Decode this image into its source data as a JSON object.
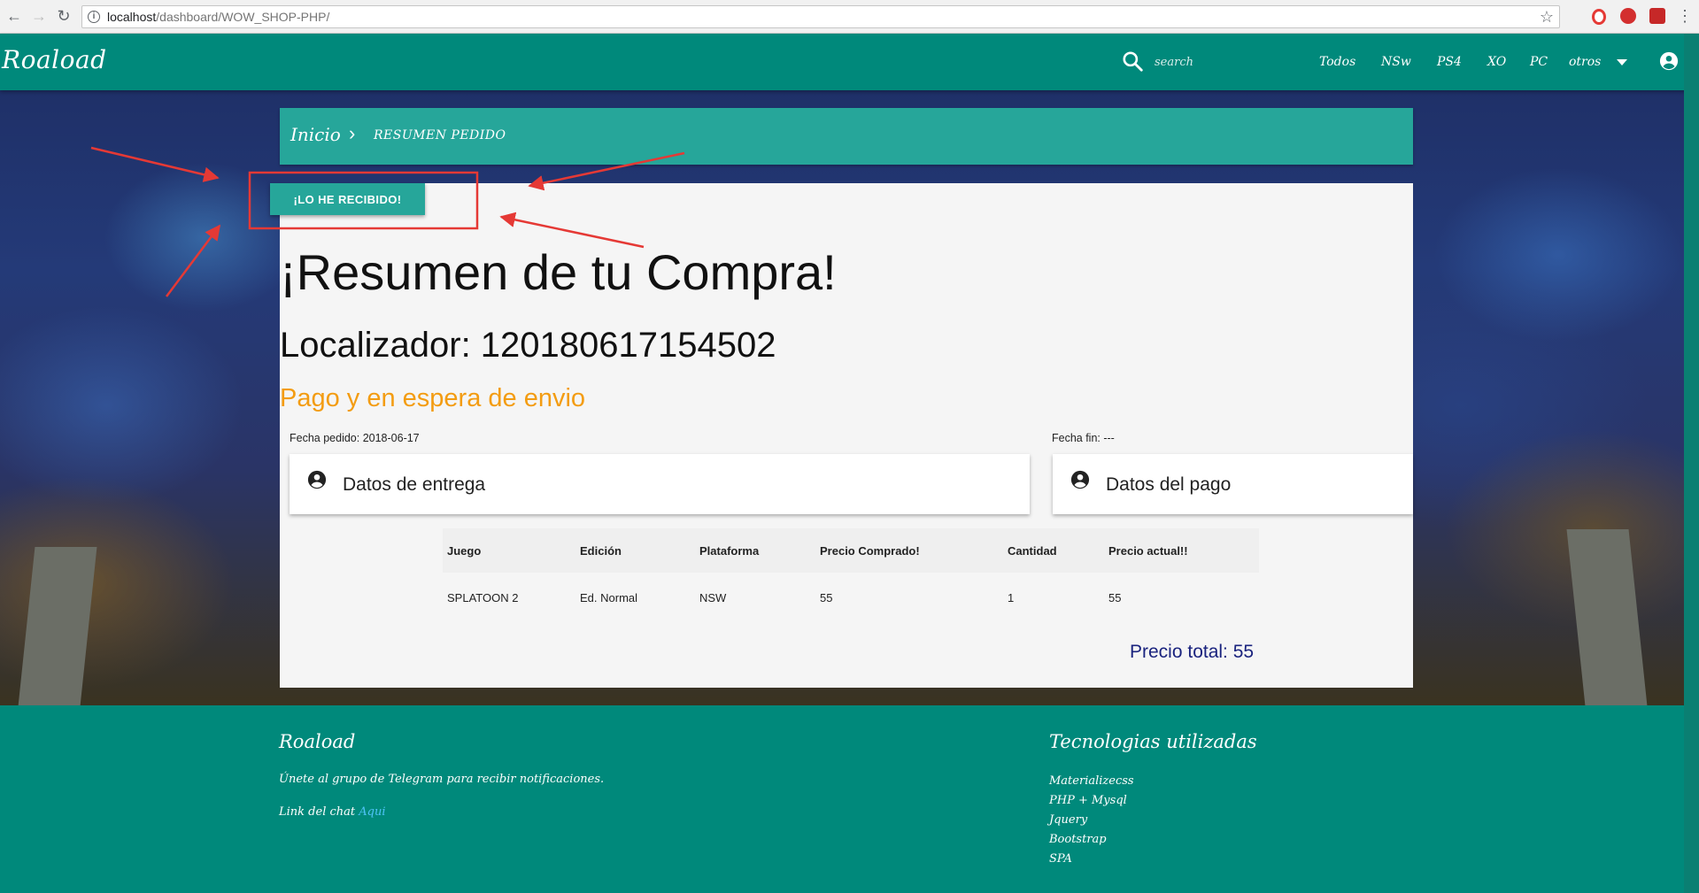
{
  "browser": {
    "url_host": "localhost",
    "url_path": "/dashboard/WOW_SHOP-PHP/",
    "back_icon": "arrow-left-icon",
    "forward_icon": "arrow-right-icon",
    "reload_icon": "reload-icon"
  },
  "navbar": {
    "brand": "Roaload",
    "search_placeholder": "search",
    "menu": [
      "Todos",
      "NSw",
      "PS4",
      "XO",
      "PC",
      "otros"
    ],
    "accent": "#00897b"
  },
  "breadcrumb": {
    "home": "Inicio",
    "separator": "›",
    "current": "RESUMEN PEDIDO"
  },
  "actions": {
    "received_button": "¡LO HE RECIBIDO!"
  },
  "summary": {
    "title": "¡Resumen de tu Compra!",
    "locator": "Localizador: 120180617154502",
    "status": "Pago y en espera de envio",
    "status_color": "#f39c12",
    "order_date": "Fecha pedido: 2018-06-17",
    "end_date": "Fecha fin: ---"
  },
  "panels": {
    "delivery": "Datos de entrega",
    "payment": "Datos del pago"
  },
  "table": {
    "headers": [
      "Juego",
      "Edición",
      "Plataforma",
      "Precio Comprado!",
      "Cantidad",
      "Precio actual!!"
    ],
    "rows": [
      [
        "SPLATOON 2",
        "Ed. Normal",
        "NSW",
        "55",
        "1",
        "55"
      ]
    ]
  },
  "total": "Precio total: 55",
  "footer": {
    "brand": "Roaload",
    "telegram_text": "Únete al grupo de Telegram para recibir notificaciones.",
    "chat_label": "Link del chat ",
    "chat_link": "Aqui",
    "tech_title": "Tecnologias utilizadas",
    "tech_items": [
      "Materializecss",
      "PHP + Mysql",
      "Jquery",
      "Bootstrap",
      "SPA"
    ]
  }
}
